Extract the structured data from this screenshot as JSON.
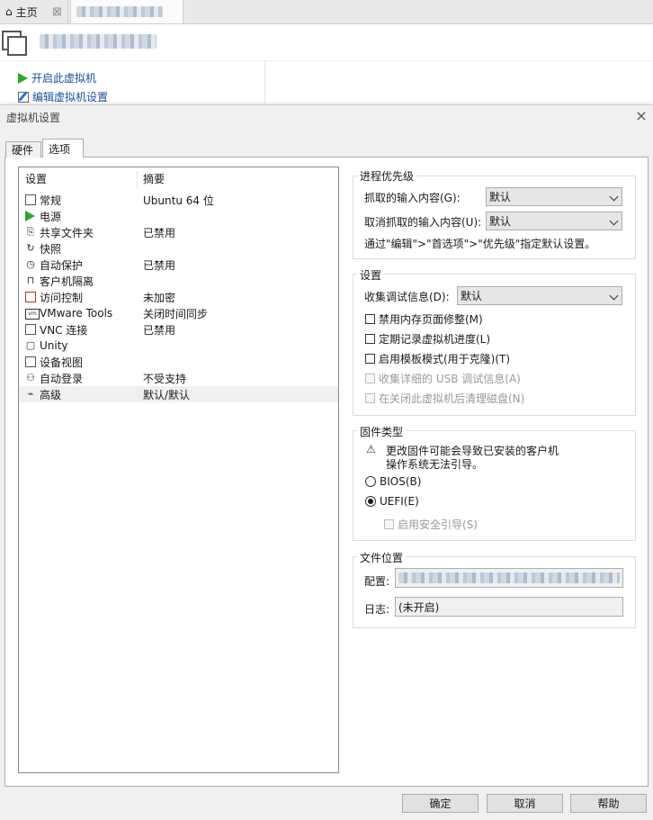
{
  "app": {
    "home_tab": "主页",
    "open_vm": "开启此虚拟机",
    "edit_vm": "编辑虚拟机设置"
  },
  "dialog": {
    "title": "虚拟机设置",
    "close": "×",
    "tabs": {
      "hardware": "硬件",
      "options": "选项"
    },
    "list": {
      "headers": {
        "setting": "设置",
        "summary": "摘要"
      },
      "rows": [
        {
          "name": "常规",
          "summary": "Ubuntu 64 位",
          "icon": "general-icon"
        },
        {
          "name": "电源",
          "summary": "",
          "icon": "power-icon"
        },
        {
          "name": "共享文件夹",
          "summary": "已禁用",
          "icon": "shared-folders-icon"
        },
        {
          "name": "快照",
          "summary": "",
          "icon": "snapshot-icon"
        },
        {
          "name": "自动保护",
          "summary": "已禁用",
          "icon": "autoprotect-icon"
        },
        {
          "name": "客户机隔离",
          "summary": "",
          "icon": "lock-icon"
        },
        {
          "name": "访问控制",
          "summary": "未加密",
          "icon": "access-control-icon"
        },
        {
          "name": "VMware Tools",
          "summary": "关闭时间同步",
          "icon": "vmware-tools-icon"
        },
        {
          "name": "VNC 连接",
          "summary": "已禁用",
          "icon": "vnc-icon"
        },
        {
          "name": "Unity",
          "summary": "",
          "icon": "unity-icon"
        },
        {
          "name": "设备视图",
          "summary": "",
          "icon": "device-view-icon"
        },
        {
          "name": "自动登录",
          "summary": "不受支持",
          "icon": "autologin-icon"
        },
        {
          "name": "高级",
          "summary": "默认/默认",
          "icon": "advanced-icon"
        }
      ]
    },
    "priority": {
      "legend": "进程优先级",
      "grabbed_label": "抓取的输入内容(G):",
      "grabbed_value": "默认",
      "ungrabbed_label": "取消抓取的输入内容(U):",
      "ungrabbed_value": "默认",
      "note": "通过\"编辑\">\"首选项\">\"优先级\"指定默认设置。"
    },
    "settings": {
      "legend": "设置",
      "debug_label": "收集调试信息(D):",
      "debug_value": "默认",
      "opt1": "禁用内存页面修整(M)",
      "opt2": "定期记录虚拟机进度(L)",
      "opt3": "启用模板模式(用于克隆)(T)",
      "opt4": "收集详细的 USB 调试信息(A)",
      "opt5": "在关闭此虚拟机后清理磁盘(N)"
    },
    "firmware": {
      "legend": "固件类型",
      "warning_line1": "更改固件可能会导致已安装的客户机",
      "warning_line2": "操作系统无法引导。",
      "bios": "BIOS(B)",
      "uefi": "UEFI(E)",
      "secure_boot": "启用安全引导(S)",
      "selected": "UEFI"
    },
    "location": {
      "legend": "文件位置",
      "config_label": "配置:",
      "log_label": "日志:",
      "log_value": "(未开启)"
    },
    "buttons": {
      "ok": "确定",
      "cancel": "取消",
      "help": "帮助"
    }
  }
}
